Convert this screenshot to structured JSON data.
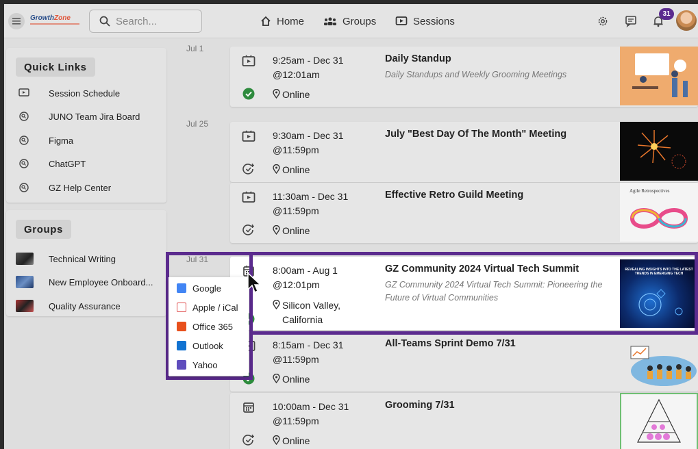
{
  "header": {
    "logo_main": "Growth",
    "logo_accent": "Zone",
    "search_placeholder": "Search...",
    "nav": [
      {
        "label": "Home",
        "icon": "home-icon"
      },
      {
        "label": "Groups",
        "icon": "groups-icon"
      },
      {
        "label": "Sessions",
        "icon": "sessions-icon"
      }
    ],
    "notification_count": "31"
  },
  "sidebar": {
    "quick_links_title": "Quick Links",
    "quick_links": [
      {
        "label": "Session Schedule",
        "icon": "session-schedule-icon"
      },
      {
        "label": "JUNO Team Jira Board",
        "icon": "external-link-icon"
      },
      {
        "label": "Figma",
        "icon": "external-link-icon"
      },
      {
        "label": "ChatGPT",
        "icon": "external-link-icon"
      },
      {
        "label": "GZ Help Center",
        "icon": "external-link-icon"
      }
    ],
    "groups_title": "Groups",
    "groups": [
      {
        "label": "Technical Writing"
      },
      {
        "label": "New Employee Onboard..."
      },
      {
        "label": "Quality Assurance"
      }
    ]
  },
  "dates": [
    "Jul 1",
    "Jul 25",
    "Jul 31"
  ],
  "events": [
    {
      "time": "9:25am - Dec 31 @12:01am",
      "location": "Online",
      "title": "Daily Standup",
      "description": "Daily Standups and Weekly Grooming Meetings",
      "status_icon": "check-circle-icon"
    },
    {
      "time": "9:30am - Dec 31 @11:59pm",
      "location": "Online",
      "title": "July \"Best Day Of The Month\" Meeting",
      "description": "",
      "status_icon": "register-icon"
    },
    {
      "time": "11:30am - Dec 31 @11:59pm",
      "location": "Online",
      "title": "Effective Retro Guild Meeting",
      "description": "",
      "status_icon": "register-icon",
      "thumb_text": "Agile Retrospectives"
    },
    {
      "time": "8:00am - Aug 1 @12:01pm",
      "location": "Silicon Valley, California",
      "title": "GZ Community 2024 Virtual Tech Summit",
      "description": "GZ Community 2024 Virtual Tech Summit: Pioneering the Future of Virtual Communities",
      "status_icon": "check-circle-icon",
      "thumb_text": "REVEALING INSIGHTS INTO THE LATEST TRENDS IN EMERGING TECH"
    },
    {
      "time": "8:15am - Dec 31 @11:59pm",
      "location": "Online",
      "title": "All-Teams Sprint Demo 7/31",
      "description": "",
      "status_icon": "check-circle-icon"
    },
    {
      "time": "10:00am - Dec 31 @11:59pm",
      "location": "Online",
      "title": "Grooming 7/31",
      "description": "",
      "status_icon": "register-icon"
    }
  ],
  "calendar_dropdown": [
    {
      "label": "Google",
      "color": "#4285f4"
    },
    {
      "label": "Apple / iCal",
      "color": "#e05050"
    },
    {
      "label": "Office 365",
      "color": "#e8501c"
    },
    {
      "label": "Outlook",
      "color": "#1273d1"
    },
    {
      "label": "Yahoo",
      "color": "#5f4dbd"
    }
  ],
  "colors": {
    "accent": "#5b2b8e",
    "success": "#2e8b3e"
  }
}
